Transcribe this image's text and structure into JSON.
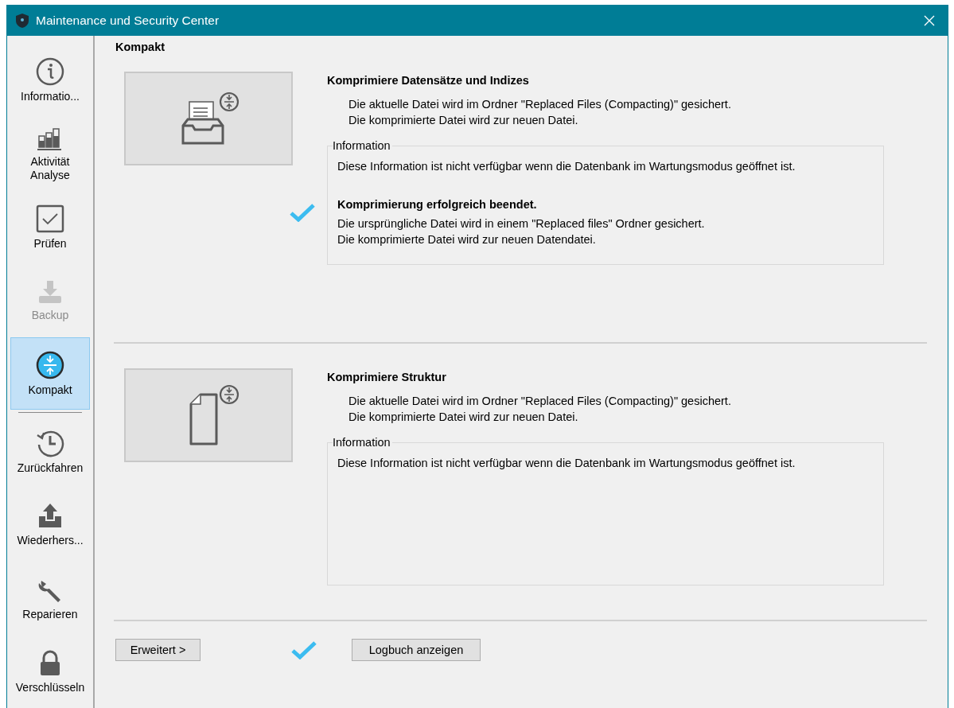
{
  "window": {
    "title": "Maintenance und Security Center"
  },
  "sidebar": {
    "items": [
      {
        "kind": "item",
        "label": "Informatio...",
        "selected": false,
        "disabled": false
      },
      {
        "kind": "item",
        "label": "Aktivität\nAnalyse",
        "selected": false,
        "disabled": false
      },
      {
        "kind": "item",
        "label": "Prüfen",
        "selected": false,
        "disabled": false
      },
      {
        "kind": "item",
        "label": "Backup",
        "selected": false,
        "disabled": true
      },
      {
        "kind": "item",
        "label": "Kompakt",
        "selected": true,
        "disabled": false
      },
      {
        "kind": "separator"
      },
      {
        "kind": "item",
        "label": "Zurückfahren",
        "selected": false,
        "disabled": false
      },
      {
        "kind": "item",
        "label": "Wiederhers...",
        "selected": false,
        "disabled": false
      },
      {
        "kind": "item",
        "label": "Reparieren",
        "selected": false,
        "disabled": false
      },
      {
        "kind": "item",
        "label": "Verschlüsseln",
        "selected": false,
        "disabled": false
      }
    ]
  },
  "page_title": "Kompakt",
  "sections": [
    {
      "title": "Komprimiere Datensätze und Indizes",
      "description": [
        "Die aktuelle Datei wird im Ordner \"Replaced Files (Compacting)\" gesichert.",
        "Die komprimierte Datei wird zur neuen Datei."
      ],
      "info": {
        "legend": "Information",
        "text": "Diese Information ist nicht verfügbar wenn die Datenbank im Wartungsmodus geöffnet ist.",
        "result": {
          "completed": true,
          "title": "Komprimierung erfolgreich beendet.",
          "lines": [
            "Die ursprüngliche Datei wird in einem \"Replaced files\" Ordner gesichert.",
            "Die komprimierte Datei wird zur neuen Datendatei."
          ]
        }
      }
    },
    {
      "title": "Komprimiere Struktur",
      "description": [
        "Die aktuelle Datei wird im Ordner \"Replaced Files (Compacting)\" gesichert.",
        "Die komprimierte Datei wird zur neuen Datei."
      ],
      "info": {
        "legend": "Information",
        "text": "Diese Information ist nicht verfügbar wenn die Datenbank im Wartungsmodus geöffnet ist."
      }
    }
  ],
  "footer": {
    "advanced_button": "Erweitert >",
    "completed": true,
    "log_button": "Logbuch anzeigen"
  }
}
